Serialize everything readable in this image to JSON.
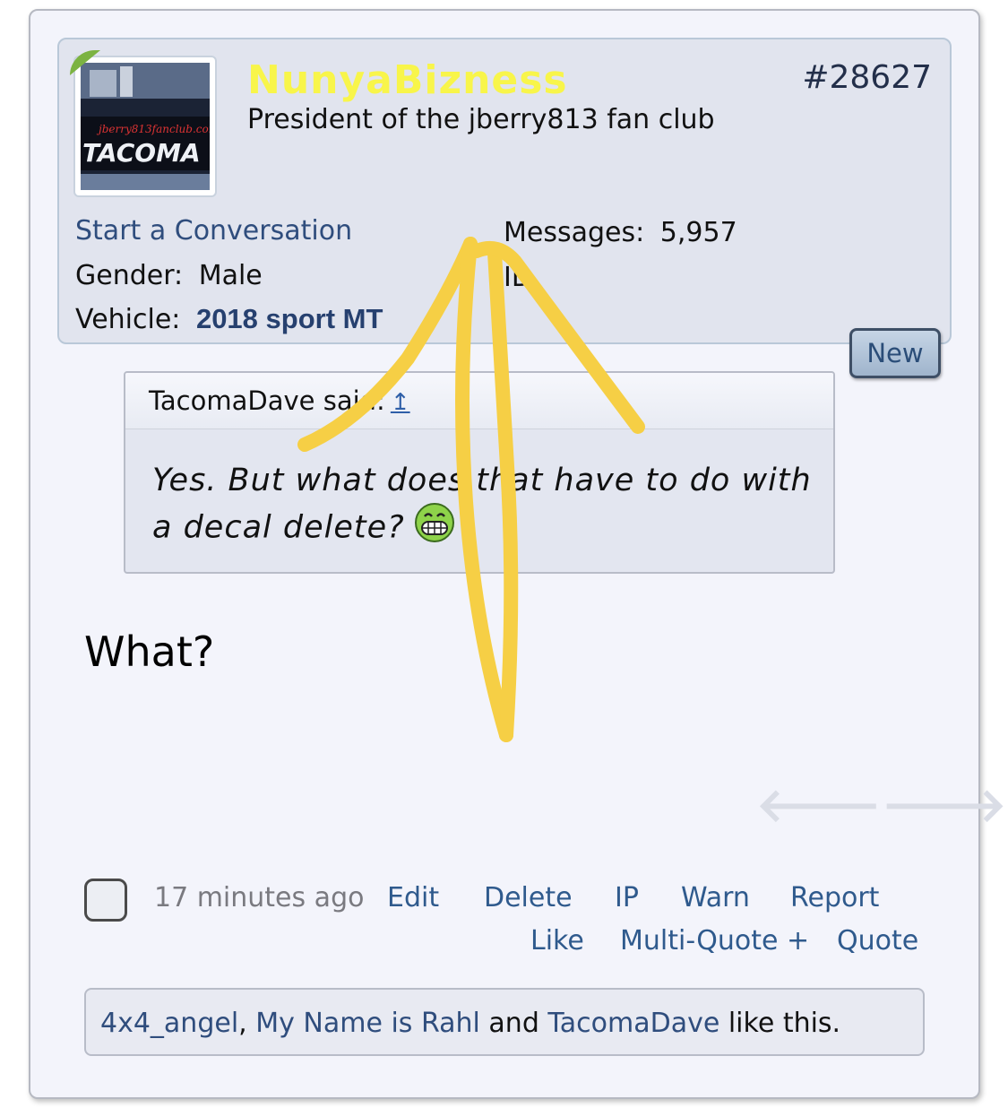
{
  "post": {
    "username": "NunyaBizness",
    "user_title": "President of the jberry813 fan club",
    "post_number": "#28627",
    "start_conversation": "Start a Conversation",
    "gender_label": "Gender:",
    "gender_value": "Male",
    "vehicle_label": "Vehicle:",
    "vehicle_value": "2018 sport MT",
    "messages_label": "Messages:",
    "messages_value": "5,957",
    "id_label": "ID",
    "new_badge": "New"
  },
  "quote": {
    "attribution": "TacomaDave said:",
    "jump_arrow": "↥",
    "text": "Yes. But what does that have to do with a decal delete?"
  },
  "message": "What?",
  "footer": {
    "timestamp": "17 minutes ago",
    "actions": {
      "edit": "Edit",
      "delete": "Delete",
      "ip": "IP",
      "warn": "Warn",
      "report": "Report",
      "like": "Like",
      "multiquote": "Multi-Quote +",
      "quote": "Quote"
    },
    "likes": {
      "user1": "4x4_angel",
      "sep1": ", ",
      "user2": "My Name is Rahl",
      "sep2": " and ",
      "user3": "TacomaDave",
      "suffix": " like this."
    }
  },
  "colors": {
    "username": "#f8f54a",
    "link": "#2f5a8d",
    "scribble": "#f6cf45"
  }
}
